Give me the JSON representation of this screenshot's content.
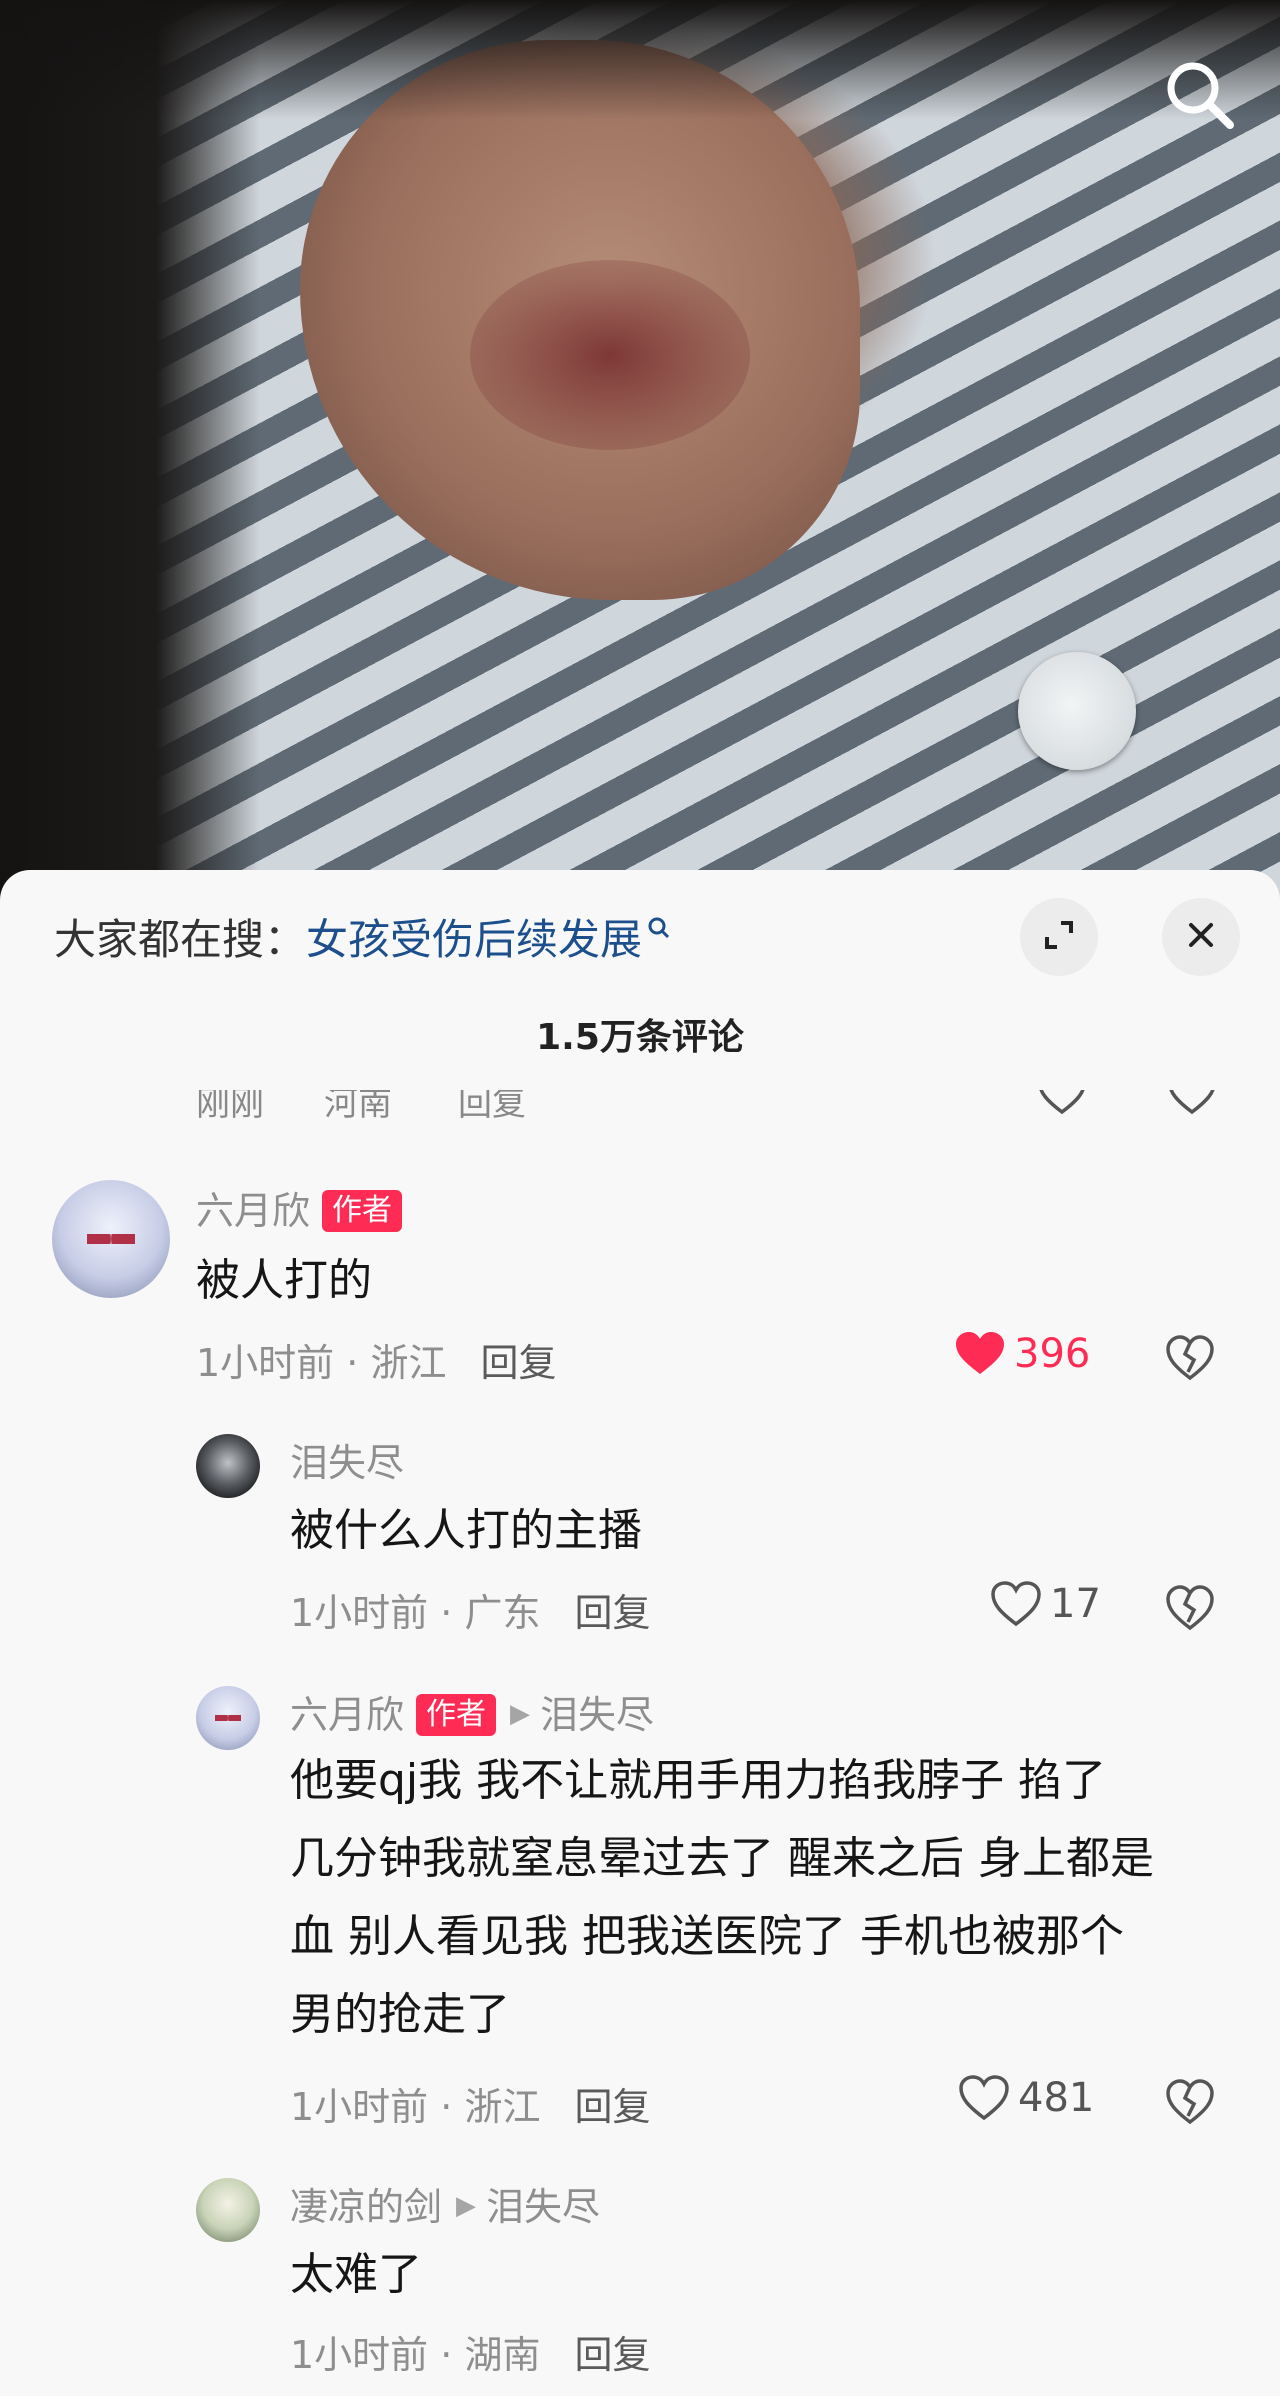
{
  "hot_search": {
    "prefix": "大家都在搜：",
    "term": "女孩受伤后续发展"
  },
  "comment_count": "1.5万条评论",
  "partial_row": {
    "time": "刚刚",
    "location": "河南",
    "reply": "回复"
  },
  "comments": [
    {
      "username": "六月欣",
      "badge": "作者",
      "text": "被人打的",
      "time": "1小时前",
      "location": "浙江",
      "reply": "回复",
      "likes": "396",
      "liked": true
    },
    {
      "username": "泪失尽",
      "text": "被什么人打的主播",
      "time": "1小时前",
      "location": "广东",
      "reply": "回复",
      "likes": "17",
      "liked": false
    },
    {
      "username": "六月欣",
      "badge": "作者",
      "reply_to": "泪失尽",
      "text_lines": [
        "他要qj我 我不让就用手用力掐我脖子 掐了",
        "几分钟我就窒息晕过去了 醒来之后 身上都是",
        "血 别人看见我 把我送医院了 手机也被那个",
        "男的抢走了"
      ],
      "time": "1小时前",
      "location": "浙江",
      "reply": "回复",
      "likes": "481",
      "liked": false
    },
    {
      "username": "凄凉的剑",
      "reply_to": "泪失尽",
      "text": "太难了",
      "time": "1小时前",
      "location": "湖南",
      "reply": "回复"
    }
  ],
  "separator": "·",
  "colors": {
    "accent": "#fe2c55",
    "search_term": "#1d4f8c",
    "meta": "#8e8e8e"
  },
  "icons": [
    "search-icon",
    "expand-icon",
    "close-icon",
    "heart-icon",
    "dislike-heart-icon",
    "reply-arrow-icon"
  ]
}
